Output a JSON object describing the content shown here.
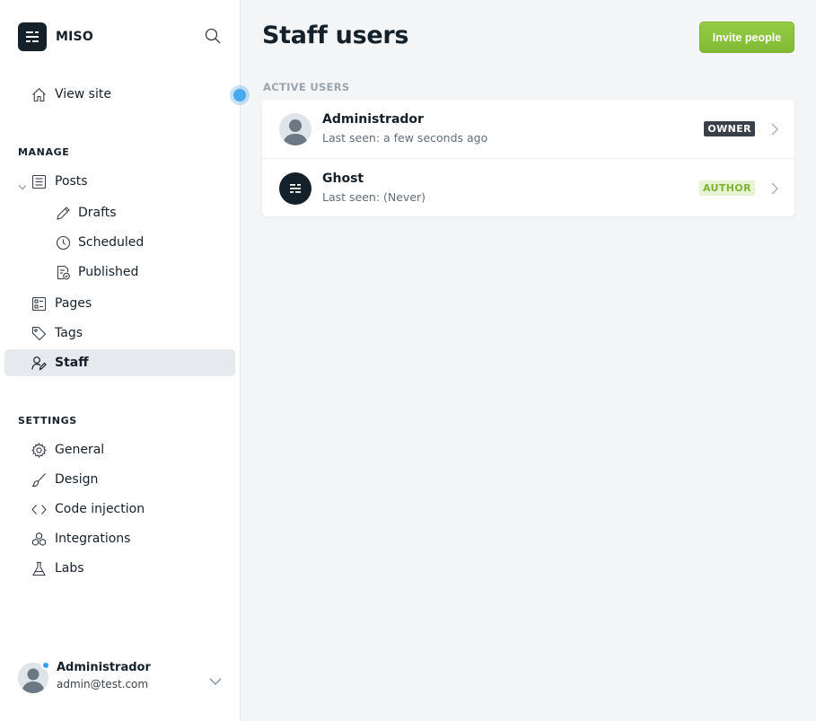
{
  "app": {
    "name": "MISO"
  },
  "colors": {
    "accent": "#8ac43a",
    "owner_badge": "#394047",
    "author_badge_text": "#7fb431",
    "online_dot": "#30a4ea"
  },
  "sidebar": {
    "view_site": "View site",
    "manage_title": "MANAGE",
    "posts": "Posts",
    "drafts": "Drafts",
    "scheduled": "Scheduled",
    "published": "Published",
    "pages": "Pages",
    "tags": "Tags",
    "staff": "Staff",
    "settings_title": "SETTINGS",
    "general": "General",
    "design": "Design",
    "code_injection": "Code injection",
    "integrations": "Integrations",
    "labs": "Labs"
  },
  "account": {
    "name": "Administrador",
    "email": "admin@test.com"
  },
  "main": {
    "title": "Staff users",
    "invite_label": "Invite people",
    "section_title": "ACTIVE USERS",
    "users": [
      {
        "name": "Administrador",
        "last_seen": "Last seen: a few seconds ago",
        "role": "OWNER"
      },
      {
        "name": "Ghost",
        "last_seen": "Last seen: (Never)",
        "role": "AUTHOR"
      }
    ]
  }
}
